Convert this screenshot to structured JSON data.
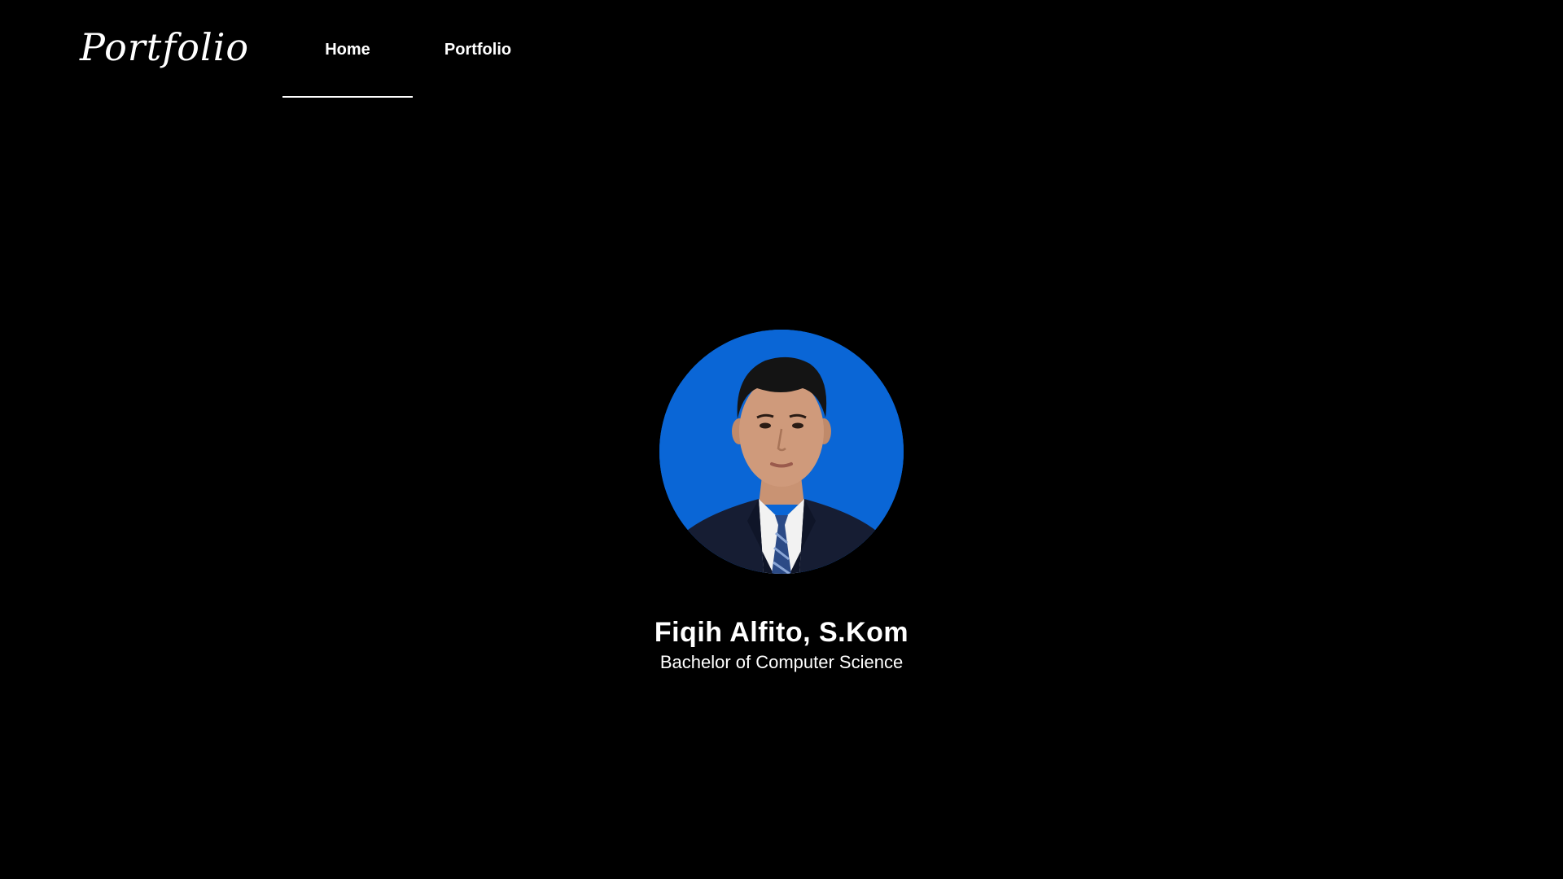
{
  "header": {
    "logo_text": "Portfolio",
    "nav": [
      {
        "label": "Home",
        "active": true
      },
      {
        "label": "Portfolio",
        "active": false
      }
    ]
  },
  "profile": {
    "name": "Fiqih Alfito, S.Kom",
    "title": "Bachelor of Computer Science",
    "photo_background": "#0a66d6"
  },
  "colors": {
    "background": "#000000",
    "text": "#ffffff"
  }
}
